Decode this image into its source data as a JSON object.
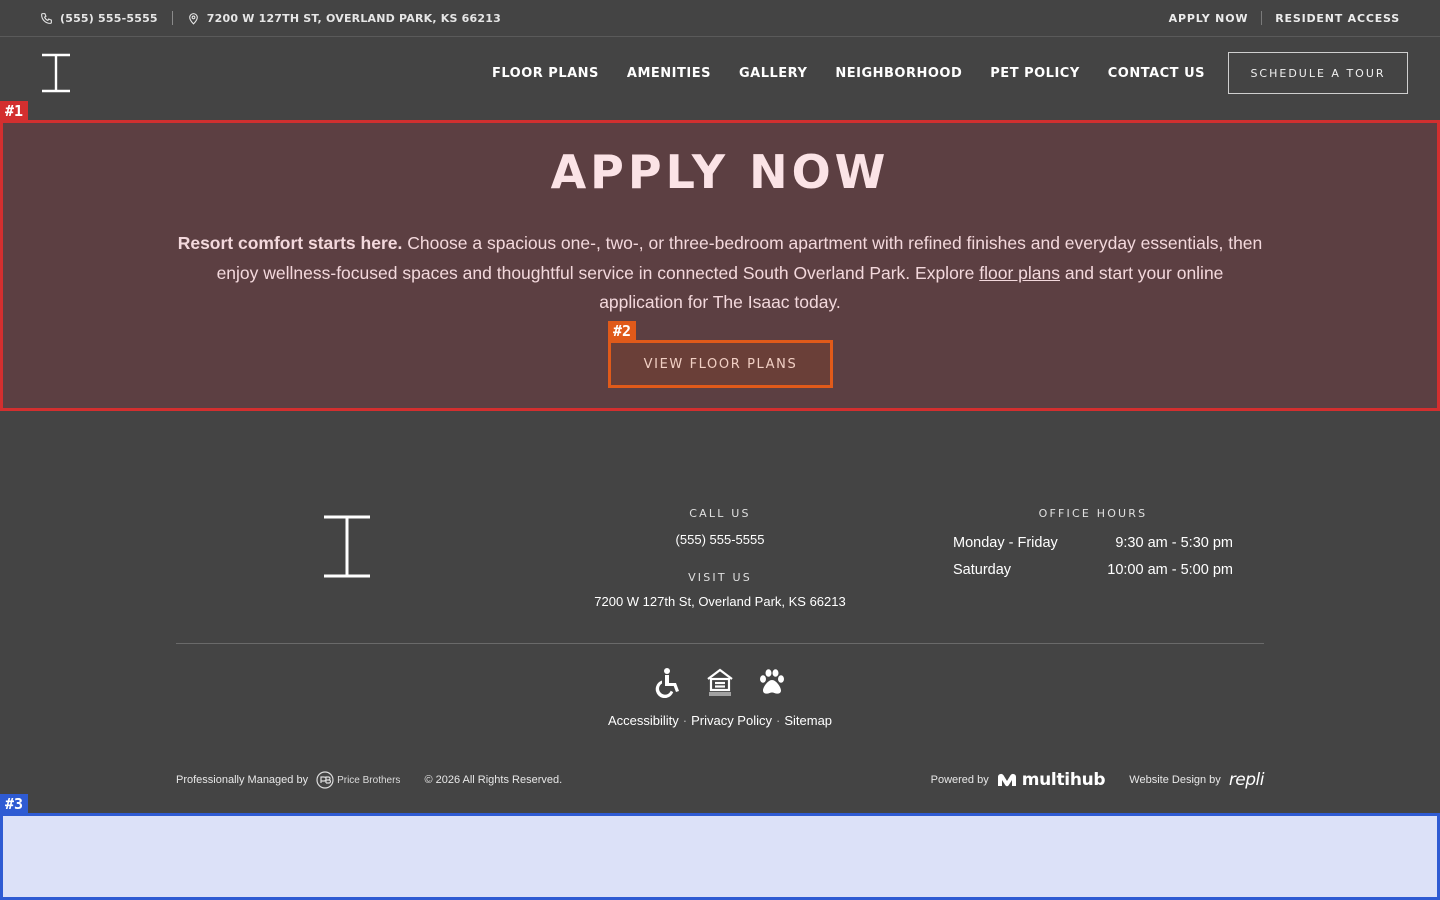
{
  "utility_bar": {
    "phone": "(555) 555-5555",
    "address": "7200 W 127TH ST, OVERLAND PARK, KS 66213",
    "apply_now": "APPLY NOW",
    "resident_access": "RESIDENT ACCESS"
  },
  "nav": {
    "items": [
      {
        "label": "FLOOR PLANS"
      },
      {
        "label": "AMENITIES"
      },
      {
        "label": "GALLERY"
      },
      {
        "label": "NEIGHBORHOOD"
      },
      {
        "label": "PET POLICY"
      },
      {
        "label": "CONTACT US"
      }
    ],
    "tour_button": "SCHEDULE A TOUR"
  },
  "annotations": {
    "tag1": "#1",
    "tag2": "#2",
    "tag3": "#3"
  },
  "apply": {
    "title": "APPLY NOW",
    "lead_bold": "Resort comfort starts here.",
    "text_before_link": " Choose a spacious one-, two-, or three-bedroom apartment with refined finishes and everyday essentials, then enjoy wellness-focused spaces and thoughtful service in connected South Overland Park. Explore ",
    "link_text": "floor plans",
    "text_after_link": " and start your online application for The Isaac today.",
    "button_label": "VIEW FLOOR PLANS"
  },
  "footer": {
    "call_label": "CALL US",
    "call_value": "(555) 555-5555",
    "visit_label": "VISIT US",
    "visit_value": "7200 W 127th St, Overland Park, KS 66213",
    "hours_label": "OFFICE HOURS",
    "hours": [
      {
        "day": "Monday - Friday",
        "time": "9:30 am - 5:30 pm"
      },
      {
        "day": "Saturday",
        "time": "10:00 am - 5:00 pm"
      }
    ],
    "links": {
      "accessibility": "Accessibility",
      "privacy": "Privacy Policy",
      "sitemap": "Sitemap",
      "separator": "·"
    },
    "managed_by": "Professionally Managed by",
    "manager_name": "Price Brothers",
    "copyright": "© 2026 All Rights Reserved.",
    "powered_by": "Powered by",
    "powered_brand": "multihub",
    "design_by": "Website Design by",
    "design_brand": "repli"
  },
  "colors": {
    "background": "#444444",
    "highlight_red": "#d32f2f",
    "highlight_orange": "#e05a1a",
    "highlight_blue": "#2f5bd3"
  },
  "icons": [
    "phone-icon",
    "location-pin-icon",
    "wheelchair-icon",
    "equal-housing-icon",
    "paw-icon"
  ]
}
